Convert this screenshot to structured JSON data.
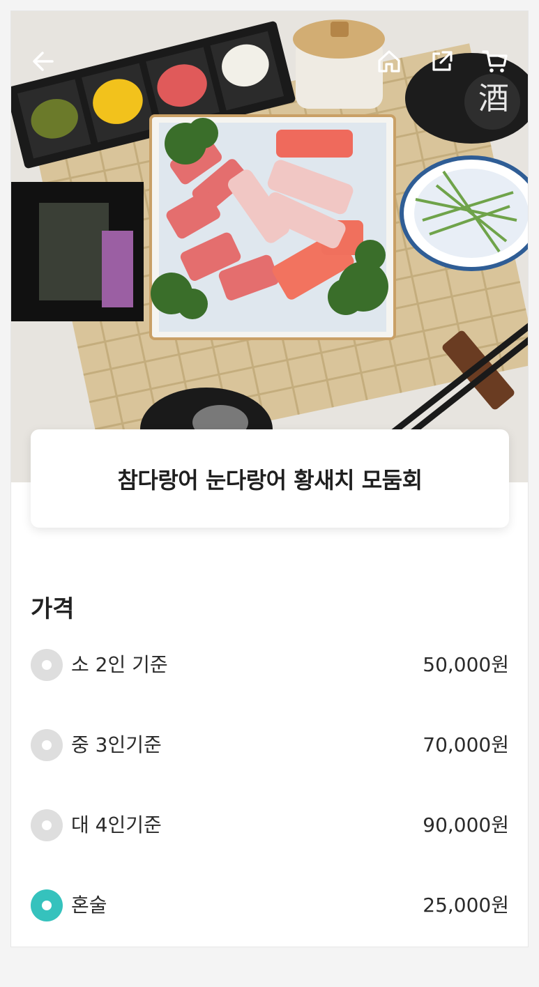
{
  "header": {
    "back_icon": "arrow-left-icon",
    "home_icon": "home-icon",
    "share_icon": "share-icon",
    "cart_icon": "cart-icon"
  },
  "product": {
    "title": "참다랑어 눈다랑어 황새치 모둠회"
  },
  "price_section": {
    "title": "가격",
    "options": [
      {
        "label": "소 2인 기준",
        "price": "50,000원",
        "selected": false
      },
      {
        "label": "중 3인기준",
        "price": "70,000원",
        "selected": false
      },
      {
        "label": "대 4인기준",
        "price": "90,000원",
        "selected": false
      },
      {
        "label": "혼술",
        "price": "25,000원",
        "selected": true
      }
    ]
  },
  "colors": {
    "accent": "#35c2bd",
    "radio_off": "#dedede"
  }
}
